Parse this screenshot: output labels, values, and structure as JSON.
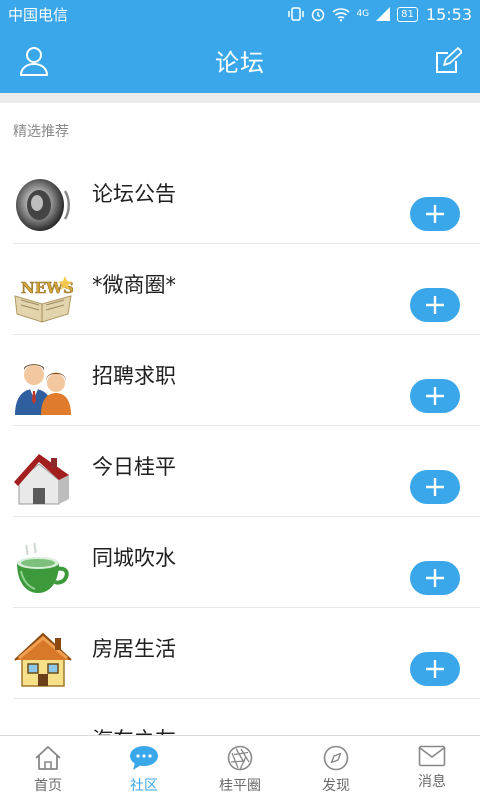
{
  "status_bar": {
    "carrier": "中国电信",
    "battery": "81",
    "network": "4G",
    "time": "15:53"
  },
  "header": {
    "title": "论坛",
    "left_icon": "user-icon",
    "right_icon": "edit-icon"
  },
  "section": {
    "label": "精选推荐"
  },
  "forums": [
    {
      "name": "论坛公告",
      "icon": "speaker-icon"
    },
    {
      "name": "*微商圈*",
      "icon": "newspaper-icon"
    },
    {
      "name": "招聘求职",
      "icon": "people-icon"
    },
    {
      "name": "今日桂平",
      "icon": "house-icon"
    },
    {
      "name": "同城吹水",
      "icon": "teacup-icon"
    },
    {
      "name": "房居生活",
      "icon": "home-icon"
    },
    {
      "name": "汽车之友",
      "icon": "car-icon"
    }
  ],
  "tabs": [
    {
      "label": "首页",
      "icon": "home-tab-icon"
    },
    {
      "label": "社区",
      "icon": "chat-bubble-icon",
      "active": true
    },
    {
      "label": "桂平圈",
      "icon": "aperture-icon"
    },
    {
      "label": "发现",
      "icon": "compass-icon"
    },
    {
      "label": "消息",
      "icon": "envelope-icon"
    }
  ],
  "colors": {
    "brand": "#3aa7ea",
    "divider": "#e6e6e6",
    "text": "#1f1f1f",
    "muted": "#8a8a8a"
  }
}
